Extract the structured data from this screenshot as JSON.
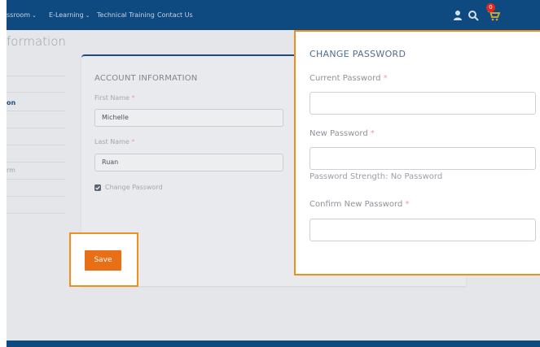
{
  "nav": {
    "items": [
      {
        "label": "ssroom",
        "chevron": "⌄"
      },
      {
        "label": "E-Learning",
        "chevron": "⌄"
      },
      {
        "label": "Technical Training"
      },
      {
        "label": "Contact Us"
      }
    ],
    "icons": [
      "user-icon",
      "search-icon",
      "cart-icon"
    ],
    "cart_count": "0"
  },
  "page": {
    "heading": "formation"
  },
  "sidebar": {
    "items": [
      {
        "label": "on",
        "active": true
      },
      {
        "label": "rm",
        "active": false
      }
    ]
  },
  "account": {
    "title": "ACCOUNT INFORMATION",
    "first_name_label": "First Name",
    "first_name_value": "Michelle",
    "last_name_label": "Last Name",
    "last_name_value": "Ruan",
    "required_mark": "*",
    "change_password_label": "Change Password",
    "change_password_checked": true
  },
  "save_label": "Save",
  "change_password": {
    "title": "CHANGE PASSWORD",
    "current_label": "Current Password",
    "new_label": "New Password",
    "strength_text": "Password Strength: No Password",
    "confirm_label": "Confirm New Password",
    "required_mark": "*"
  },
  "colors": {
    "nav_bg": "#0e4a80",
    "accent_orange": "#e86f16",
    "highlight_border": "#ee8f1e",
    "badge_red": "#e0281f"
  }
}
